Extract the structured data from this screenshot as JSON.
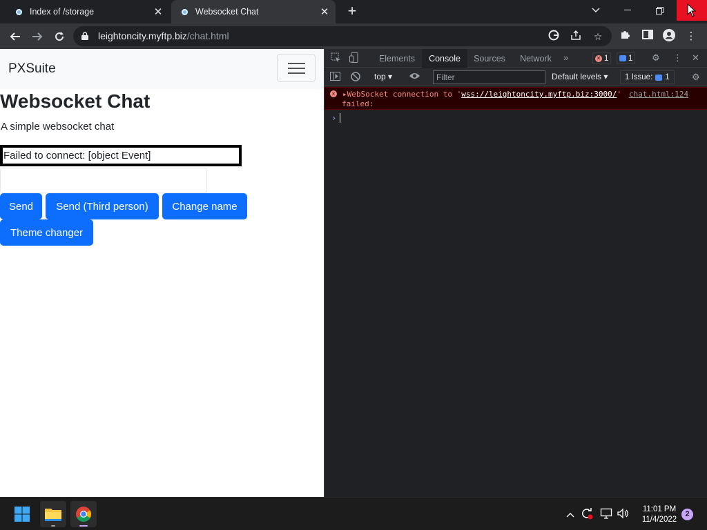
{
  "browser": {
    "tabs": [
      {
        "title": "Index of /storage",
        "active": false
      },
      {
        "title": "Websocket Chat",
        "active": true
      }
    ],
    "address": {
      "host": "leightoncity.myftp.biz",
      "path": "/chat.html"
    }
  },
  "page": {
    "brand": "PXSuite",
    "heading": "Websocket Chat",
    "lead": "A simple websocket chat",
    "status": "Failed to connect: [object Event]",
    "message_input_value": "",
    "buttons": {
      "send": "Send",
      "send_third": "Send (Third person)",
      "change_name": "Change name",
      "theme": "Theme changer"
    }
  },
  "devtools": {
    "tabs": [
      "Elements",
      "Console",
      "Sources",
      "Network"
    ],
    "active_tab": "Console",
    "error_count": "1",
    "message_count": "1",
    "context": "top",
    "filter_placeholder": "Filter",
    "levels": "Default levels",
    "issues_label": "1 Issue:",
    "issues_count": "1",
    "console": {
      "error_prefix": "WebSocket connection to '",
      "error_url": "wss://leightoncity.myftp.biz:3000/",
      "error_suffix": "'",
      "error_line2": "failed:",
      "error_source": "chat.html:124"
    }
  },
  "taskbar": {
    "time": "11:01 PM",
    "date": "11/4/2022",
    "notifications": "2"
  },
  "colors": {
    "primary_button": "#0d6efd",
    "devtools_bg": "#202124",
    "error_text": "#f28b82",
    "error_bg": "#290000"
  }
}
